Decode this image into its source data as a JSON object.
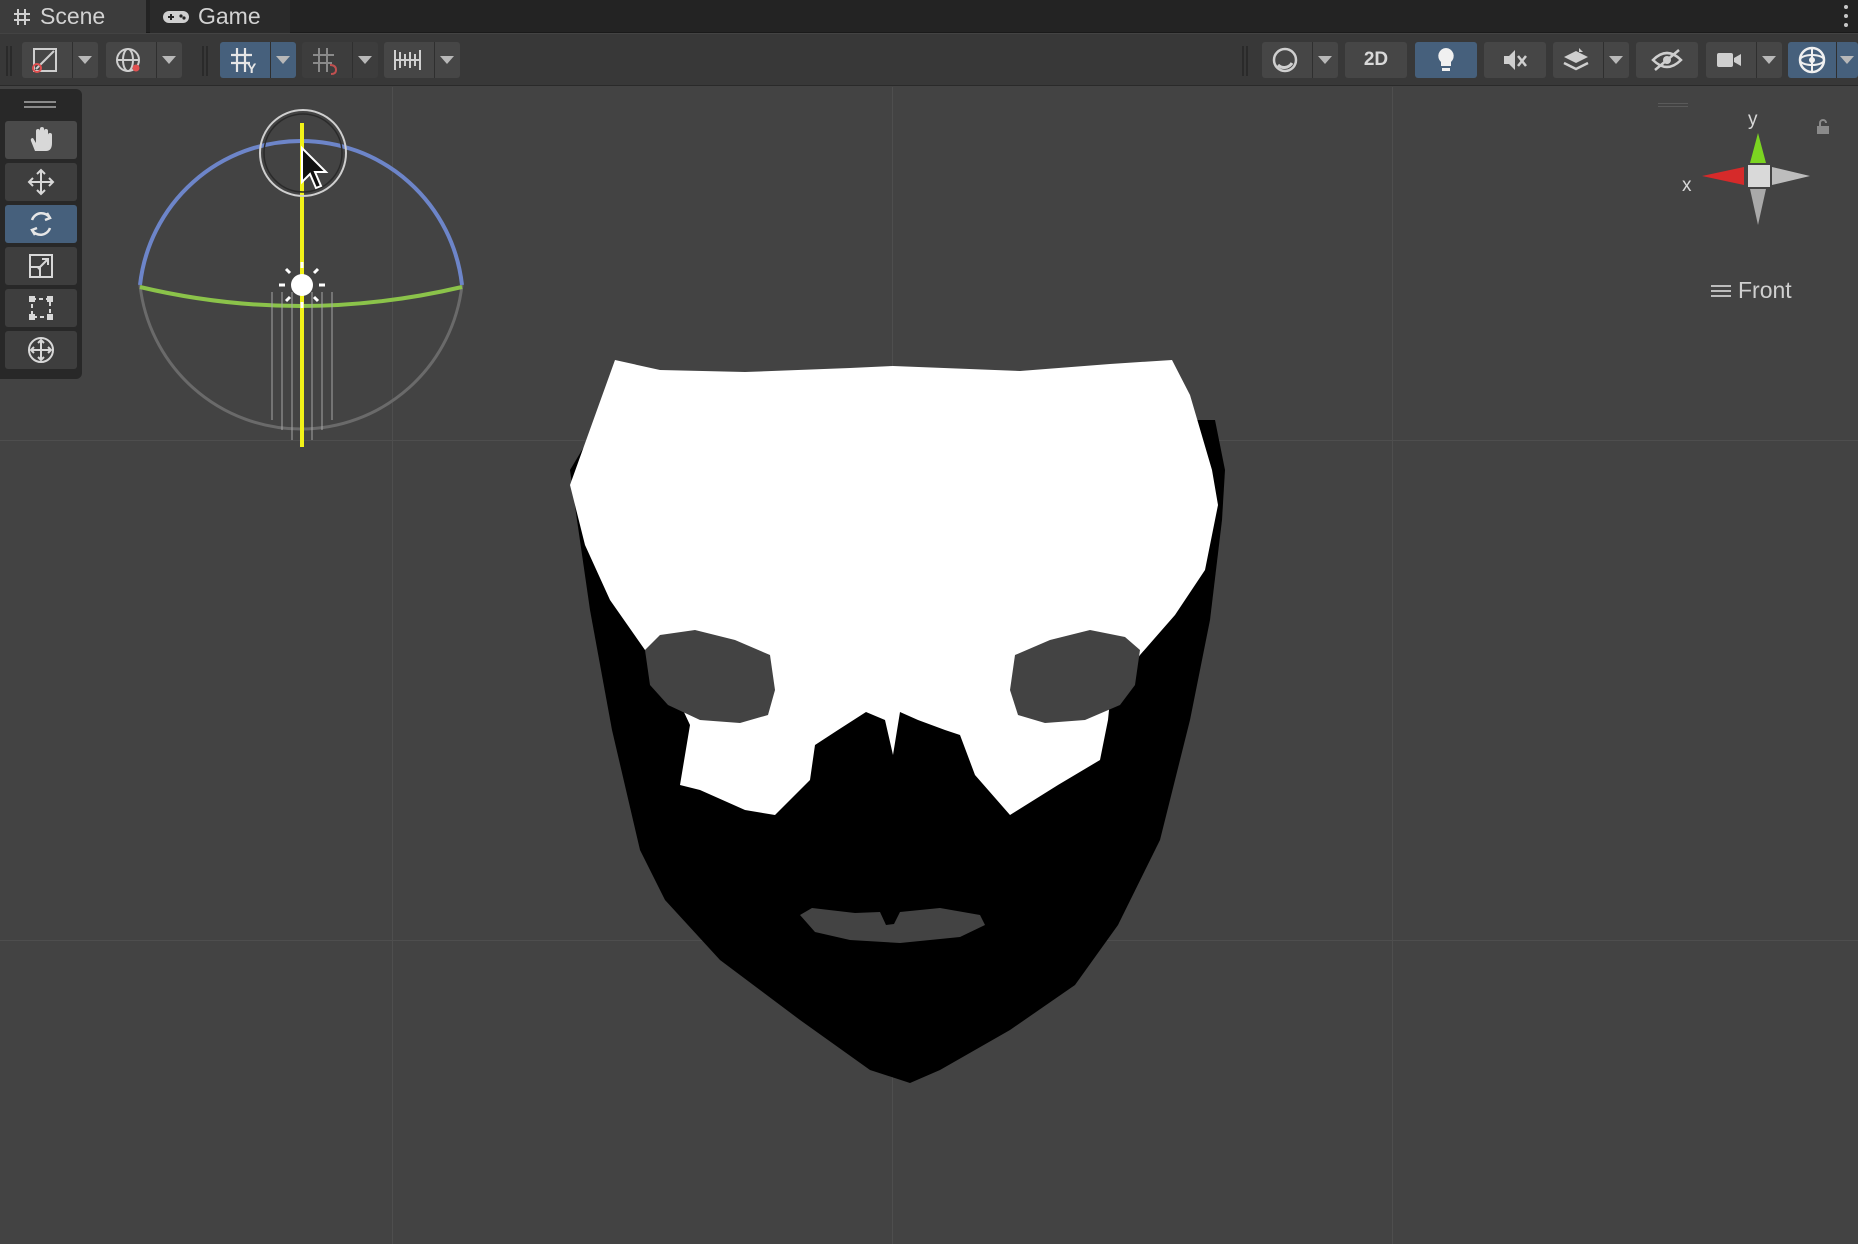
{
  "tabs": [
    {
      "label": "Scene",
      "icon": "grid-hash-icon",
      "active": true
    },
    {
      "label": "Game",
      "icon": "gamepad-icon",
      "active": false
    }
  ],
  "toolbar": {
    "left": [
      {
        "name": "draw-mode-dropdown",
        "icon": "draw-mode-icon"
      },
      {
        "name": "global-local-dropdown",
        "icon": "globe-icon"
      },
      {
        "name": "grid-snapping-toggle",
        "icon": "grid-snap-icon",
        "active": true
      },
      {
        "name": "incremental-snap-toggle",
        "icon": "incremental-snap-icon"
      },
      {
        "name": "ruler-snap-dropdown",
        "icon": "ruler-icon"
      }
    ],
    "right": [
      {
        "name": "shading-mode-dropdown",
        "icon": "shading-sphere-icon"
      },
      {
        "name": "2d-toggle",
        "label": "2D"
      },
      {
        "name": "lighting-toggle",
        "icon": "lightbulb-icon",
        "active": true
      },
      {
        "name": "audio-toggle",
        "icon": "speaker-muted-icon"
      },
      {
        "name": "effects-dropdown",
        "icon": "layers-icon"
      },
      {
        "name": "hidden-objects-toggle",
        "icon": "eye-slash-icon"
      },
      {
        "name": "camera-dropdown",
        "icon": "camera-icon"
      },
      {
        "name": "gizmos-dropdown",
        "icon": "gizmo-globe-icon",
        "active": true
      }
    ]
  },
  "tools": [
    {
      "name": "hand-tool",
      "icon": "hand-icon"
    },
    {
      "name": "move-tool",
      "icon": "move-arrows-icon"
    },
    {
      "name": "rotate-tool",
      "icon": "rotate-icon",
      "active": true
    },
    {
      "name": "scale-tool",
      "icon": "scale-icon"
    },
    {
      "name": "rect-tool",
      "icon": "rect-icon"
    },
    {
      "name": "transform-tool",
      "icon": "transform-icon"
    }
  ],
  "viewport": {
    "view_label": "Front",
    "axis_x": "x",
    "axis_y": "y",
    "colors": {
      "background": "#434343",
      "mask_white": "#ffffff",
      "mask_black": "#000000",
      "axis_x": "#d62a2a",
      "axis_y": "#7bd421",
      "rotate_blue": "#6d85c9",
      "rotate_green": "#8bc34a",
      "rotate_yellow": "#f2f218"
    }
  }
}
